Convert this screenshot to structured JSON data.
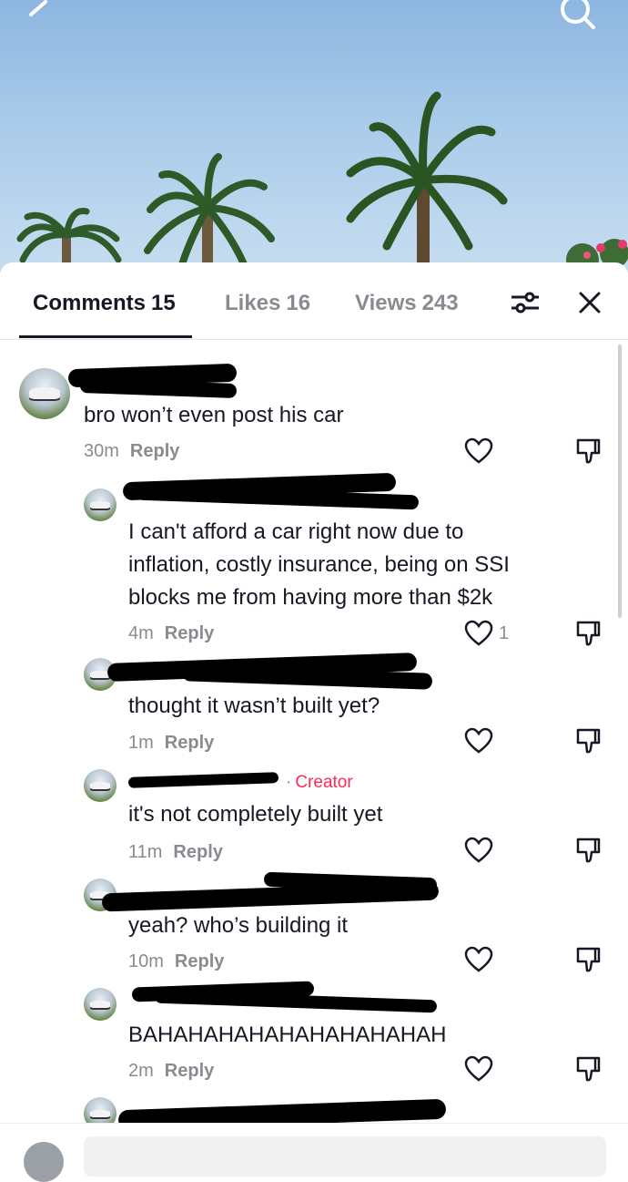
{
  "tabs": {
    "comments_label": "Comments",
    "comments_count": "15",
    "likes_label": "Likes",
    "likes_count": "16",
    "views_label": "Views",
    "views_count": "243"
  },
  "icons": {
    "back": "chevron-left-icon",
    "search": "search-icon",
    "filter": "filter-sliders-icon",
    "close": "close-icon",
    "like": "heart-outline-icon",
    "dislike": "thumbs-down-icon"
  },
  "colors": {
    "creator_badge": "#fe2c55",
    "text_primary": "#161823",
    "text_secondary": "#8a8b91"
  },
  "comments": [
    {
      "text": "bro won’t even post his car",
      "time": "30m",
      "reply": "Reply",
      "likes": ""
    },
    {
      "text": "I can't afford a car right now due to\ninflation, costly insurance, being on SSI\nblocks me from having more than $2k",
      "time": "4m",
      "reply": "Reply",
      "likes": "1"
    },
    {
      "text": "thought it wasn’t built yet?",
      "time": "1m",
      "reply": "Reply",
      "likes": ""
    },
    {
      "badge": "Creator",
      "text": "it's not completely built yet",
      "time": "11m",
      "reply": "Reply",
      "likes": ""
    },
    {
      "text": "yeah? who’s building it",
      "time": "10m",
      "reply": "Reply",
      "likes": ""
    },
    {
      "text": "BAHAHAHAHAHAHAHAHAHAH",
      "time": "2m",
      "reply": "Reply",
      "likes": ""
    }
  ]
}
